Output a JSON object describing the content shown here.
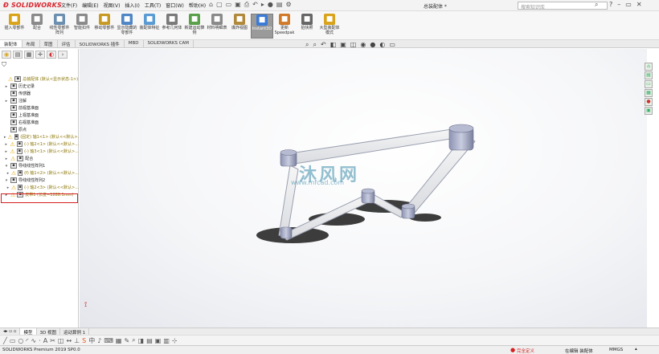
{
  "app": {
    "logo": "SOLIDWORKS",
    "doc_title": "总装配体 *"
  },
  "menu": [
    "文件(F)",
    "编辑(E)",
    "视图(V)",
    "插入(I)",
    "工具(T)",
    "窗口(W)",
    "帮助(H)"
  ],
  "search_placeholder": "搜索知识库",
  "ribbon": [
    {
      "label": "插入零部件",
      "icon": "insert-component-icon",
      "color": "#d9a31c"
    },
    {
      "label": "配合",
      "icon": "mate-icon",
      "color": "#8a8a8a"
    },
    {
      "label": "线性零部件阵列",
      "icon": "linear-pattern-icon",
      "color": "#6b8fb0"
    },
    {
      "label": "智能扣件",
      "icon": "smart-fastener-icon",
      "color": "#8a8a8a"
    },
    {
      "label": "移动零部件",
      "icon": "move-component-icon",
      "color": "#c79a24"
    },
    {
      "label": "显示隐藏的零部件",
      "icon": "show-hidden-icon",
      "color": "#4f86c6"
    },
    {
      "label": "装配体特征",
      "icon": "assembly-feature-icon",
      "color": "#5a9bd4"
    },
    {
      "label": "参考几何体",
      "icon": "reference-geometry-icon",
      "color": "#7a7a7a"
    },
    {
      "label": "新建运动算例",
      "icon": "motion-study-icon",
      "color": "#5aa04a"
    },
    {
      "label": "材料明细表",
      "icon": "bom-icon",
      "color": "#8a8a8a"
    },
    {
      "label": "爆炸视图",
      "icon": "exploded-view-icon",
      "color": "#b08a3a"
    },
    {
      "label": "Instant3D",
      "icon": "instant3d-icon",
      "color": "#3c7bd6"
    },
    {
      "label": "更新 Speedpak",
      "icon": "speedpak-icon",
      "color": "#d07a2a"
    },
    {
      "label": "拍快照",
      "icon": "snapshot-icon",
      "color": "#666666"
    },
    {
      "label": "大型装配体模式",
      "icon": "large-assembly-icon",
      "color": "#d9a31c"
    }
  ],
  "cmd_tabs": [
    "装配体",
    "布局",
    "草图",
    "评估",
    "SOLIDWORKS 插件",
    "MBD",
    "SOLIDWORKS CAM"
  ],
  "tree": [
    {
      "text": "总装配体 (默认<显示状态-1>)",
      "ind": 0,
      "car": "",
      "warn": true,
      "y": true
    },
    {
      "text": "历史记录",
      "ind": 1,
      "car": "▸"
    },
    {
      "text": "传感器",
      "ind": 1,
      "car": ""
    },
    {
      "text": "注解",
      "ind": 1,
      "car": "▸"
    },
    {
      "text": "前视基准面",
      "ind": 1,
      "car": ""
    },
    {
      "text": "上视基准面",
      "ind": 1,
      "car": ""
    },
    {
      "text": "右视基准面",
      "ind": 1,
      "car": ""
    },
    {
      "text": "原点",
      "ind": 1,
      "car": ""
    },
    {
      "text": "(固定) 轴1<1> (默认<<默认>...",
      "ind": 1,
      "car": "▸",
      "warn": true,
      "y": true
    },
    {
      "text": "(-) 轴2<1> (默认<<默认>...",
      "ind": 1,
      "car": "▸",
      "warn": true,
      "y": true
    },
    {
      "text": "(-) 轴3<1> (默认<<默认>...",
      "ind": 1,
      "car": "▸",
      "warn": true,
      "y": true
    },
    {
      "text": "配合",
      "ind": 1,
      "car": "▸",
      "warn": true
    },
    {
      "text": "导线线性阵列1",
      "ind": 1,
      "car": "▾"
    },
    {
      "text": "(f) 轴1<2> (默认<<默认>...",
      "ind": 2,
      "car": "▸",
      "warn": true,
      "y": true
    },
    {
      "text": "导线线性阵列2",
      "ind": 1,
      "car": "▾"
    },
    {
      "text": "(-) 轴2<3> (默认<<默认>...",
      "ind": 2,
      "car": "▸",
      "warn": true,
      "y": true
    },
    {
      "text": "皮带1 (长度=1288.1mm)",
      "ind": 1,
      "car": "▸",
      "warn": true,
      "y": true
    }
  ],
  "watermark": {
    "text": "沐风网",
    "url": "www.mfcad.com"
  },
  "bottom_tabs": [
    "模型",
    "3D 视图",
    "运动算例 1"
  ],
  "status": {
    "left": "SOLIDWORKS Premium 2019 SP0.0",
    "warn": "完全定义",
    "mode": "在编辑 装配体",
    "units": "MMGS"
  }
}
